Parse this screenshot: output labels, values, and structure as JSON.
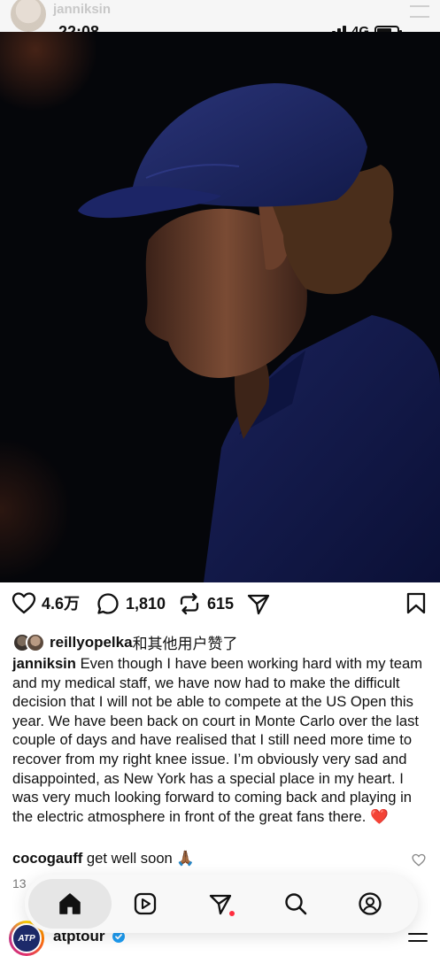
{
  "status_bar": {
    "time": "22:08",
    "network": "4G"
  },
  "prev_header": {
    "username": "janniksin"
  },
  "post": {
    "likes": "4.6万",
    "comments": "1,810",
    "reposts": "615",
    "liked_by_user": "reillyopelka",
    "liked_by_suffix": "和其他用户赞了",
    "caption_user": "janniksin",
    "caption_text": "Even though I have been working hard with my team and my medical staff, we have now had to make the difficult decision that I will not be able to compete at the US Open this year. We have been back on court in Monte Carlo over the last couple of days and have realised that I still need more time to recover from my right knee issue. I’m obviously very sad and disappointed, as New York has a special place in my heart. I was very much looking forward to coming back and playing in the electric atmosphere in front of the great fans there.",
    "caption_emoji": "❤️",
    "top_comment": {
      "user": "cocogauff",
      "text": "get well soon",
      "emoji": "🙏🏾"
    },
    "partial_count": "13"
  },
  "next_post": {
    "username": "atptour",
    "avatar_text": "ATP"
  },
  "colors": {
    "accent_red": "#ff2d3f",
    "heart": "#e0202a",
    "verified": "#1d9bf0"
  },
  "icons": {
    "actions": [
      "heart-icon",
      "comment-icon",
      "repost-icon",
      "share-icon",
      "bookmark-icon"
    ],
    "nav": [
      "home-icon",
      "reels-icon",
      "send-icon",
      "search-icon",
      "profile-icon"
    ]
  }
}
